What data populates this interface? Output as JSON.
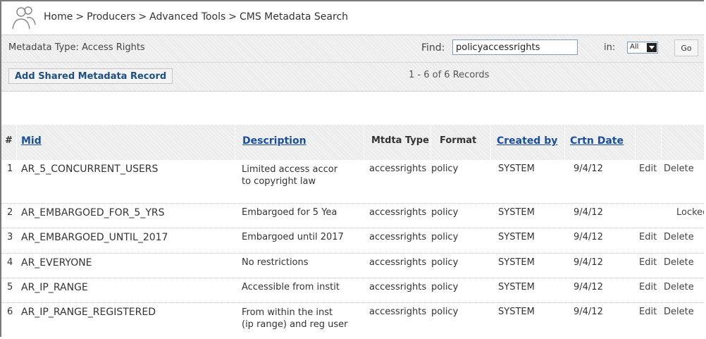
{
  "breadcrumb": [
    "Home",
    "Producers",
    "Advanced Tools",
    "CMS Metadata Search"
  ],
  "breadcrumb_separator": ">",
  "filter": {
    "metadata_type_label": "Metadata Type: Access Rights",
    "find_label": "Find:",
    "find_value": "policyaccessrights",
    "in_label": "in:",
    "in_selected": "All",
    "go_label": "Go"
  },
  "actions": {
    "add_label": "Add Shared Metadata Record",
    "records_text": "1 - 6 of 6 Records"
  },
  "table": {
    "headers": {
      "num": "#",
      "mid": "Mid",
      "description": "Description",
      "mtdta_type": "Mtdta Type",
      "format": "Format",
      "created_by": "Created by",
      "crtn_date": "Crtn Date"
    },
    "rows": [
      {
        "num": "1",
        "mid": "AR_5_CONCURRENT_USERS",
        "desc1": "Limited access accor",
        "desc2": "to copyright law",
        "type": "accessrights",
        "format": "policy",
        "created_by": "SYSTEM",
        "date": "9/4/12",
        "edit": "Edit",
        "delete": "Delete"
      },
      {
        "num": "2",
        "mid": "AR_EMBARGOED_FOR_5_YRS",
        "desc1": "Embargoed for 5 Yea",
        "desc2": "",
        "type": "accessrights",
        "format": "policy",
        "created_by": "SYSTEM",
        "date": "9/4/12",
        "edit": "",
        "delete": "Locked"
      },
      {
        "num": "3",
        "mid": "AR_EMBARGOED_UNTIL_2017",
        "desc1": "Embargoed until 2017",
        "desc2": "",
        "type": "accessrights",
        "format": "policy",
        "created_by": "SYSTEM",
        "date": "9/4/12",
        "edit": "Edit",
        "delete": "Delete"
      },
      {
        "num": "4",
        "mid": "AR_EVERYONE",
        "desc1": "No restrictions",
        "desc2": "",
        "type": "accessrights",
        "format": "policy",
        "created_by": "SYSTEM",
        "date": "9/4/12",
        "edit": "Edit",
        "delete": "Delete"
      },
      {
        "num": "5",
        "mid": "AR_IP_RANGE",
        "desc1": "Accessible from instit",
        "desc2": "",
        "type": "accessrights",
        "format": "policy",
        "created_by": "SYSTEM",
        "date": "9/4/12",
        "edit": "Edit",
        "delete": "Delete"
      },
      {
        "num": "6",
        "mid": "AR_IP_RANGE_REGISTERED",
        "desc1": "From within the inst",
        "desc2": "(ip range) and reg user",
        "type": "accessrights",
        "format": "policy",
        "created_by": "SYSTEM",
        "date": "9/4/12",
        "edit": "Edit",
        "delete": "Delete"
      }
    ]
  },
  "icons": {
    "logo": "users-icon",
    "select_arrow": "chevron-down-icon"
  },
  "colors": {
    "link": "#1a4fa0",
    "hatch_bg": "#ececec",
    "frame_border": "#7a7a7a"
  }
}
